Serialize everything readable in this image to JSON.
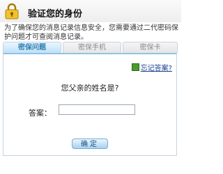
{
  "header": {
    "title": "验证您的身份",
    "icon": "lock-icon"
  },
  "description": "为了确保您的消息记录信息安全，您需要通过二代密码保护问题才可查阅消息记录。",
  "tabs": [
    {
      "label": "密保问题",
      "active": true
    },
    {
      "label": "密保手机",
      "active": false
    },
    {
      "label": "密保卡",
      "active": false
    }
  ],
  "panel": {
    "forgot_link": "忘记答案?",
    "question": "您父亲的姓名是?",
    "answer_label": "答案：",
    "answer_value": "",
    "confirm_button": "确定"
  },
  "colors": {
    "active_tab": "#bfe1f6",
    "active_tab_text": "#2f7fb1",
    "link": "#1a3f8f",
    "button": "#a9d1ef"
  }
}
